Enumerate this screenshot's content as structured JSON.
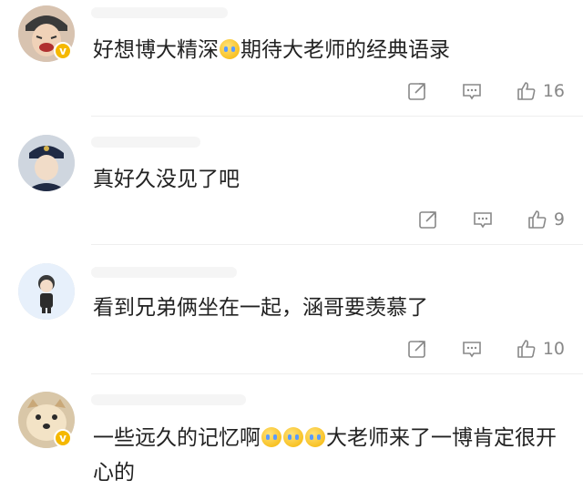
{
  "comments": [
    {
      "text": "好想博大精深😭期待大老师的经典语录",
      "text_before": "好想博大精深",
      "text_after": "期待大老师的经典语录",
      "verified": true,
      "likes": "16"
    },
    {
      "text": "真好久没见了吧",
      "verified": false,
      "likes": "9"
    },
    {
      "text": "看到兄弟俩坐在一起，涵哥要羡慕了",
      "verified": false,
      "likes": "10"
    },
    {
      "text_before": "一些远久的记忆啊",
      "text_after": "大老师来了一博肯定很开心的",
      "verified": true
    }
  ],
  "icons": {
    "share": "share-icon",
    "comment": "comment-icon",
    "like": "thumbs-up-icon",
    "emoji": "crying-emoji-icon"
  },
  "colors": {
    "text": "#222222",
    "meta": "#888888",
    "badge": "#f5b800",
    "divider": "#eeeeee"
  }
}
